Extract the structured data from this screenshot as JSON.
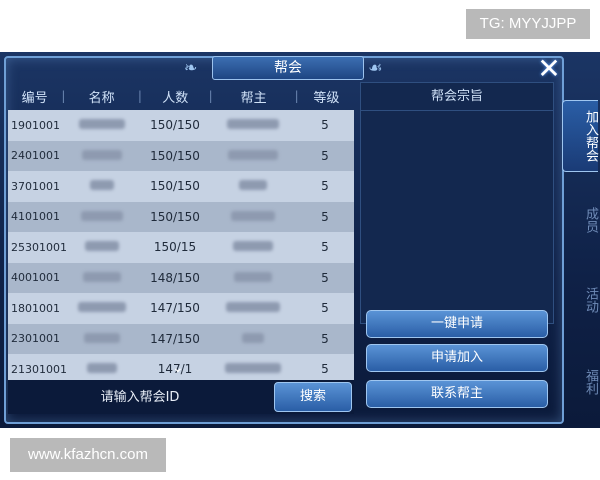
{
  "overlay": {
    "tg": "TG: MYYJJPP",
    "watermark": "www.kfazhcn.com"
  },
  "dialog": {
    "title": "帮会",
    "close": "✕"
  },
  "table": {
    "columns": [
      "编号",
      "名称",
      "人数",
      "帮主",
      "等级"
    ],
    "rows": [
      {
        "id": "1901001",
        "members": "150/150",
        "level": "5"
      },
      {
        "id": "2401001",
        "members": "150/150",
        "level": "5"
      },
      {
        "id": "3701001",
        "members": "150/150",
        "level": "5"
      },
      {
        "id": "4101001",
        "members": "150/150",
        "level": "5"
      },
      {
        "id": "25301001",
        "members": "150/15",
        "level": "5"
      },
      {
        "id": "4001001",
        "members": "148/150",
        "level": "5"
      },
      {
        "id": "1801001",
        "members": "147/150",
        "level": "5"
      },
      {
        "id": "2301001",
        "members": "147/150",
        "level": "5"
      },
      {
        "id": "21301001",
        "members": "147/1",
        "level": "5"
      }
    ]
  },
  "search": {
    "placeholder": "请输入帮会ID",
    "button": "搜索"
  },
  "purpose": {
    "title": "帮会宗旨"
  },
  "actions": {
    "quick_apply": "一键申请",
    "apply_join": "申请加入",
    "contact_leader": "联系帮主"
  },
  "tabs": {
    "join": "加入帮会",
    "members": "成员",
    "events": "活动",
    "welfare": "福利"
  }
}
